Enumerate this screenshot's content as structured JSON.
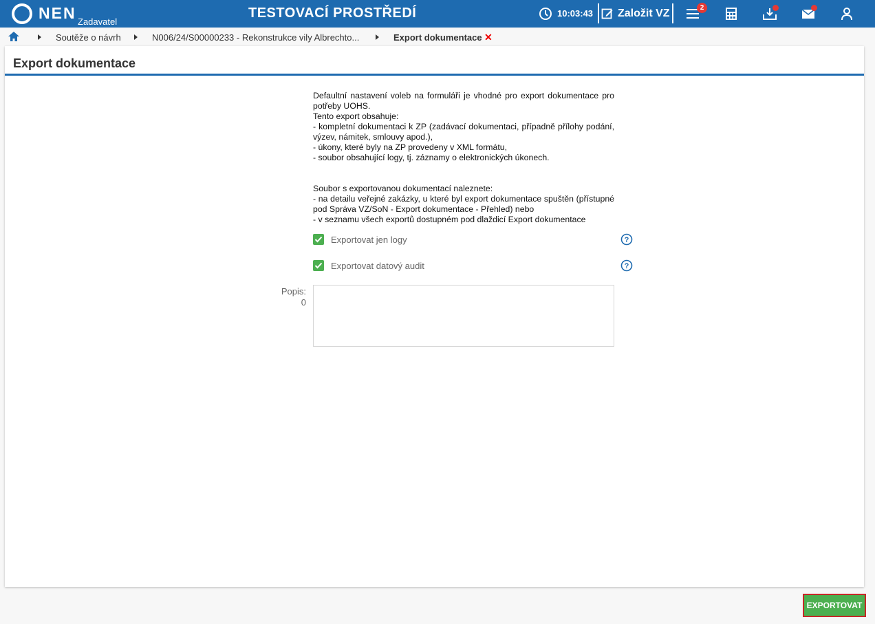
{
  "header": {
    "logo_text": "NEN",
    "logo_sub": "Zadavatel",
    "env_title": "TESTOVACÍ PROSTŘEDÍ",
    "time": "10:03:43",
    "new_vz_label": "Založit VZ",
    "menu_badge": "2",
    "colors": {
      "bar": "#1e6bb0",
      "badge": "#e53935"
    }
  },
  "breadcrumb": {
    "items": [
      "Soutěže o návrh",
      "N006/24/S00000233 - Rekonstrukce vily Albrechto...",
      "Export dokumentace"
    ],
    "close_symbol": "✕"
  },
  "page": {
    "title": "Export dokumentace",
    "intro_lines_1": [
      "Defaultní nastavení voleb na formuláři je vhodné pro export dokumentace pro potřeby UOHS.",
      "Tento export obsahuje:",
      "- kompletní dokumentaci k ZP (zadávací dokumentaci, případně přílohy podání, výzev, námitek, smlouvy apod.),",
      "- úkony, které byly na ZP provedeny v XML formátu,",
      "- soubor obsahující logy, tj. záznamy o elektronických úkonech."
    ],
    "intro_lines_2": [
      "Soubor s exportovanou dokumentací naleznete:",
      "- na detailu veřejné zakázky, u které byl export dokumentace spuštěn (přístupné pod Správa VZ/SoN - Export dokumentace - Přehled) nebo",
      "- v seznamu všech exportů dostupném pod dlaždicí Export dokumentace"
    ],
    "checkboxes": [
      {
        "label": "Exportovat jen logy",
        "checked": true
      },
      {
        "label": "Exportovat datový audit",
        "checked": true
      }
    ],
    "popis_label": "Popis:",
    "popis_count": "0",
    "popis_value": "",
    "export_button": "EXPORTOVAT"
  }
}
